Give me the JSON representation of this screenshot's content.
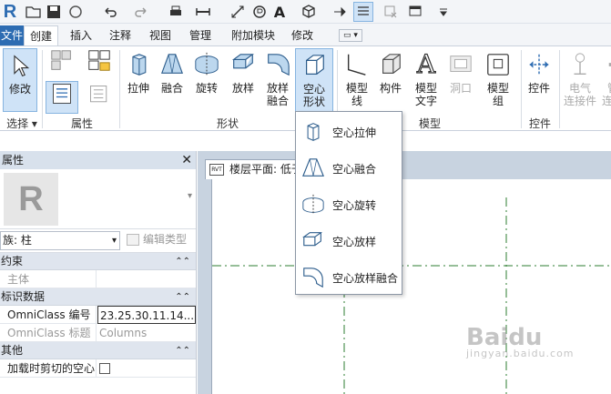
{
  "app": {
    "logo": "R"
  },
  "qat": {
    "icons": [
      "open-icon",
      "save-icon",
      "sync-icon",
      "undo-icon",
      "redo-icon",
      "print-icon",
      "measure-icon",
      "dimension-icon",
      "tag-icon",
      "text-icon",
      "3d-view-icon",
      "section-icon",
      "thin-lines-icon",
      "close-windows-icon",
      "switch-windows-icon",
      "customize-icon"
    ]
  },
  "tabs": [
    {
      "label": "文件"
    },
    {
      "label": "创建"
    },
    {
      "label": "插入"
    },
    {
      "label": "注释"
    },
    {
      "label": "视图"
    },
    {
      "label": "管理"
    },
    {
      "label": "附加模块"
    },
    {
      "label": "修改"
    }
  ],
  "ribbon": {
    "modify": "修改",
    "select_label": "选择 ▾",
    "properties_label": "属性",
    "shape_label": "形状",
    "model_label": "模型",
    "control_label": "控件",
    "buttons": {
      "extrusion": "拉伸",
      "blend": "融合",
      "revolve": "旋转",
      "sweep": "放样",
      "swept_blend_1": "放样",
      "swept_blend_2": "融合",
      "void_1": "空心",
      "void_2": "形状",
      "model_line_1": "模型",
      "model_line_2": "线",
      "component": "构件",
      "model_text_1": "模型",
      "model_text_2": "文字",
      "opening": "洞口",
      "model_group_1": "模型",
      "model_group_2": "组",
      "control": "控件",
      "electrical_1": "电气",
      "electrical_2": "连接件",
      "pipe_1": "管道",
      "pipe_2": "连接件"
    }
  },
  "void_menu": [
    {
      "label": "空心拉伸",
      "icon": "void-extrusion-icon"
    },
    {
      "label": "空心融合",
      "icon": "void-blend-icon"
    },
    {
      "label": "空心旋转",
      "icon": "void-revolve-icon"
    },
    {
      "label": "空心放样",
      "icon": "void-sweep-icon"
    },
    {
      "label": "空心放样融合",
      "icon": "void-swept-blend-icon"
    }
  ],
  "properties": {
    "title": "属性",
    "family": "族: 柱",
    "edit_type": "编辑类型",
    "sections": [
      {
        "name": "约束",
        "rows": [
          {
            "key": "主体",
            "value": "",
            "gray": true
          }
        ]
      },
      {
        "name": "标识数据",
        "rows": [
          {
            "key": "OmniClass 编号",
            "value": "23.25.30.11.14...",
            "gray": false
          },
          {
            "key": "OmniClass 标题",
            "value": "Columns",
            "gray": true
          }
        ]
      },
      {
        "name": "其他",
        "rows": [
          {
            "key": "加载时剪切的空心",
            "value": "",
            "gray": false
          }
        ]
      }
    ]
  },
  "view": {
    "tab_title": "楼层平面: 低于参照标高"
  },
  "watermark": {
    "text": "Baidu",
    "sub": "jingyan.baidu.com"
  },
  "colors": {
    "accent": "#2d6cb2",
    "panel_bg": "#d8e1ec",
    "grid_line": "#2e7d32"
  }
}
